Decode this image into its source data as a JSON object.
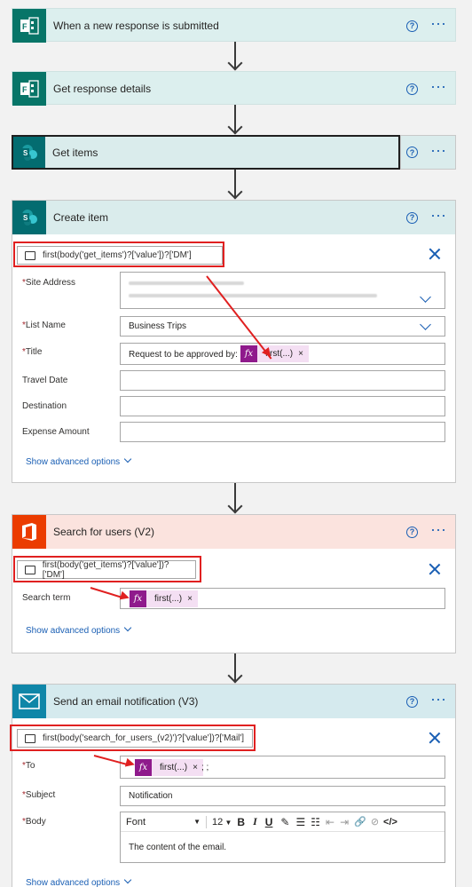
{
  "colors": {
    "forms_header": "#dcefee",
    "sharepoint_header": "#daecec",
    "office_header": "#fbe3de",
    "mail_header": "#d5eaee",
    "accent": "#1a5fb4",
    "fx": "#8f1a8c",
    "annotation": "#e02020"
  },
  "steps": {
    "trigger": {
      "title": "When a new response is submitted",
      "icon": "forms-icon"
    },
    "get_response": {
      "title": "Get response details",
      "icon": "forms-icon"
    },
    "get_items": {
      "title": "Get items",
      "icon": "sharepoint-icon"
    },
    "create_item": {
      "title": "Create item",
      "icon": "sharepoint-icon",
      "expression": "first(body('get_items')?['value'])?['DM']",
      "site_address_label": "Site Address",
      "list_name_label": "List Name",
      "list_name_value": "Business Trips",
      "title_label": "Title",
      "title_prefix": "Request to be approved by:",
      "title_token": "first(...)",
      "travel_date_label": "Travel Date",
      "destination_label": "Destination",
      "expense_label": "Expense Amount",
      "advanced": "Show advanced options"
    },
    "search_users": {
      "title": "Search for users (V2)",
      "icon": "office-icon",
      "expression": "first(body('get_items')?['value'])?['DM']",
      "search_term_label": "Search term",
      "search_token": "first(...)",
      "advanced": "Show advanced options"
    },
    "send_email": {
      "title": "Send an email notification (V3)",
      "icon": "mail-icon",
      "expression": "first(body('search_for_users_(v2)')?['value'])?['Mail']",
      "to_label": "To",
      "to_token": "first(...)",
      "to_suffix": "; ;",
      "subject_label": "Subject",
      "subject_value": "Notification",
      "body_label": "Body",
      "font_value": "Font",
      "font_size": "12",
      "body_value": "The content of the email.",
      "advanced": "Show advanced options"
    }
  },
  "common": {
    "required_mark": "*",
    "help_glyph": "?",
    "more_glyph": "···",
    "remove_glyph": "×",
    "fx_glyph": "fx"
  }
}
